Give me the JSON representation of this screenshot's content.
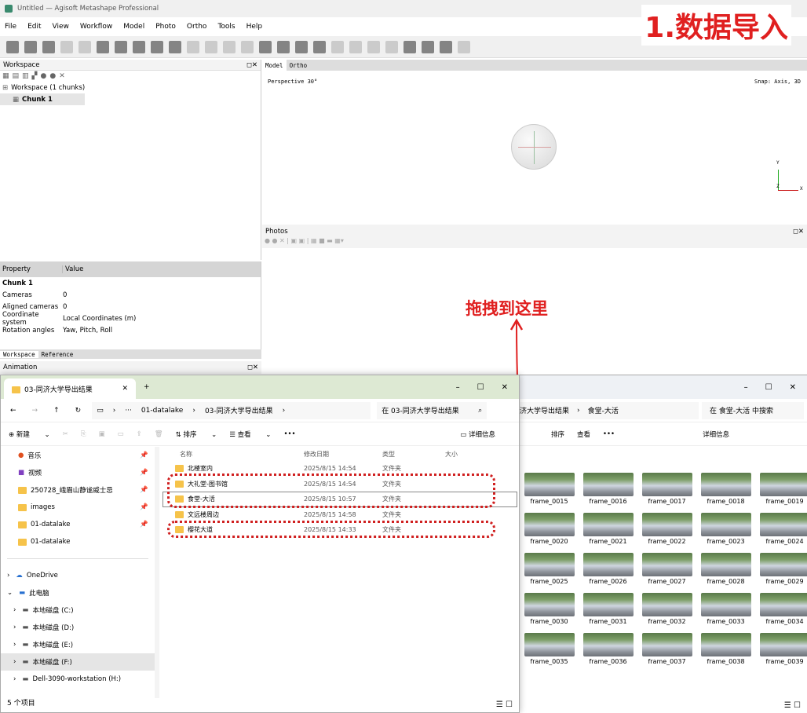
{
  "app": {
    "title": "Untitled — Agisoft Metashape Professional",
    "corner_title": "1.数据导入"
  },
  "menu": [
    "File",
    "Edit",
    "View",
    "Workflow",
    "Model",
    "Photo",
    "Ortho",
    "Tools",
    "Help"
  ],
  "workspace": {
    "panel_title": "Workspace",
    "root_label": "Workspace (1 chunks)",
    "chunk_label": "Chunk 1"
  },
  "properties": {
    "header_property": "Property",
    "header_value": "Value",
    "section": "Chunk 1",
    "rows": [
      {
        "k": "Cameras",
        "v": "0"
      },
      {
        "k": "Aligned cameras",
        "v": "0"
      },
      {
        "k": "Coordinate system",
        "v": "Local Coordinates (m)"
      },
      {
        "k": "Rotation angles",
        "v": "Yaw, Pitch, Roll"
      }
    ]
  },
  "bottom_tabs": [
    "Workspace",
    "Reference"
  ],
  "animation_title": "Animation",
  "viewport": {
    "tabs": [
      "Model",
      "Ortho"
    ],
    "perspective": "Perspective 30°",
    "snap": "Snap: Axis, 3D",
    "axis_y": "Y",
    "axis_z": "Z",
    "axis_x": "X"
  },
  "photos_title": "Photos",
  "drag_note": "拖拽到这里",
  "explorer": {
    "tab_title": "03-同济大学导出结果",
    "breadcrumb": [
      "01-datalake",
      "03-同济大学导出结果"
    ],
    "search_placeholder": "在 03-同济大学导出结果",
    "commands": [
      "新建",
      "排序",
      "查看",
      "•••"
    ],
    "details_label": "详细信息",
    "columns": [
      "名称",
      "修改日期",
      "类型",
      "大小"
    ],
    "nav": [
      {
        "label": "音乐"
      },
      {
        "label": "视频"
      },
      {
        "label": "250728_峨眉山静谧威士忌"
      },
      {
        "label": "images"
      },
      {
        "label": "01-datalake"
      },
      {
        "label": "01-datalake"
      }
    ],
    "nav_tree": [
      {
        "label": "OneDrive"
      },
      {
        "label": "此电脑"
      },
      {
        "label": "本地磁盘 (C:)"
      },
      {
        "label": "本地磁盘 (D:)"
      },
      {
        "label": "本地磁盘 (E:)"
      },
      {
        "label": "本地磁盘 (F:)"
      },
      {
        "label": "Dell-3090-workstation (H:)"
      }
    ],
    "files": [
      {
        "name": "北楼室内",
        "date": "2025/8/15 14:54",
        "type": "文件夹"
      },
      {
        "name": "大礼堂-图书馆",
        "date": "2025/8/15 14:54",
        "type": "文件夹"
      },
      {
        "name": "食堂-大活",
        "date": "2025/8/15 10:57",
        "type": "文件夹"
      },
      {
        "name": "文远楼周边",
        "date": "2025/8/15 14:58",
        "type": "文件夹"
      },
      {
        "name": "樱花大道",
        "date": "2025/8/15 14:33",
        "type": "文件夹"
      }
    ],
    "status": "5 个项目"
  },
  "explorer2": {
    "breadcrumb_tail": "食堂-大活",
    "breadcrumb_prev": "济大学导出结果",
    "search": "在 食堂-大活 中搜索",
    "commands": [
      "排序",
      "查看",
      "•••"
    ],
    "details_label": "详细信息",
    "frames": [
      "frame_0015",
      "frame_0016",
      "frame_0017",
      "frame_0018",
      "frame_0019",
      "frame_0020",
      "frame_0021",
      "frame_0022",
      "frame_0023",
      "frame_0024",
      "frame_0025",
      "frame_0026",
      "frame_0027",
      "frame_0028",
      "frame_0029",
      "frame_0030",
      "frame_0031",
      "frame_0032",
      "frame_0033",
      "frame_0034",
      "frame_0035",
      "frame_0036",
      "frame_0037",
      "frame_0038",
      "frame_0039"
    ]
  },
  "colors": {
    "accent_red": "#e02020",
    "folder": "#f6c34a"
  }
}
